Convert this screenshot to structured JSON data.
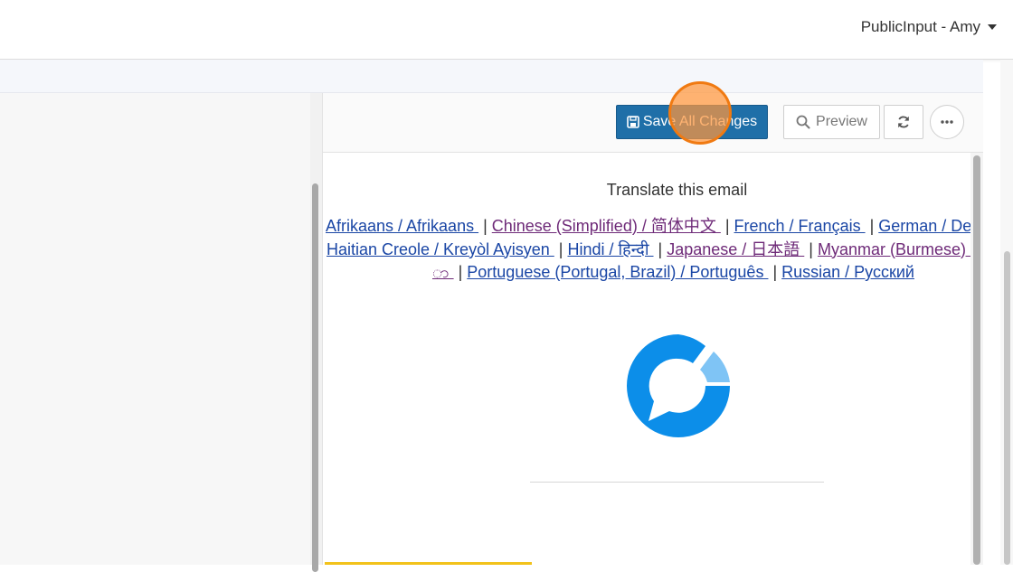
{
  "header": {
    "account_label": "PublicInput - Amy"
  },
  "toolbar": {
    "save_label": "Save All Changes",
    "preview_label": "Preview"
  },
  "email": {
    "translate_heading": "Translate this email",
    "languages_row1": [
      {
        "label": "Afrikaans / Afrikaans ",
        "visited": false
      },
      {
        "label": "Chinese (Simplified) / 简体中文 ",
        "visited": true
      },
      {
        "label": "French / Français ",
        "visited": false
      },
      {
        "label": "German / Deutsch",
        "visited": false
      }
    ],
    "languages_row2": [
      {
        "label": "Haitian Creole / Kreyòl Ayisyen ",
        "visited": false
      },
      {
        "label": "Hindi / हिन्दी ",
        "visited": false
      },
      {
        "label": "Japanese / 日本語 ",
        "visited": true
      },
      {
        "label": "Myanmar (Burmese) / မြန်မာ",
        "visited": true
      }
    ],
    "languages_row3": [
      {
        "label": "ာ ",
        "visited": true
      },
      {
        "label": "Portuguese (Portugal, Brazil) / Português ",
        "visited": false
      },
      {
        "label": "Russian / Русский",
        "visited": false
      }
    ],
    "separator": "|"
  },
  "colors": {
    "primary_button": "#1f6fa8",
    "link": "#1a46a5",
    "visited_link": "#6e2a78",
    "logo_blue": "#0c8ee9",
    "logo_light_blue": "#7fc4f5",
    "click_marker": "#f07a12"
  },
  "icons": {
    "save": "floppy-disk-icon",
    "preview": "search-icon",
    "refresh": "refresh-icon",
    "more": "ellipsis-icon",
    "account_dropdown": "caret-down-icon"
  }
}
